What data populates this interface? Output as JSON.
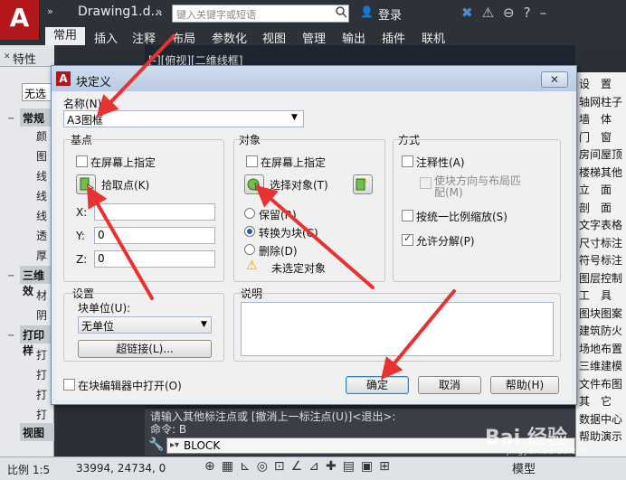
{
  "app": {
    "logo": "A",
    "qat_arrows": "»",
    "doc_title": "Drawing1.d...",
    "title_more": "»",
    "search_placeholder": "键入关键字或短语",
    "login": "登录",
    "tabs": [
      "常用",
      "插入",
      "注释",
      "布局",
      "参数化",
      "视图",
      "管理",
      "输出",
      "插件",
      "联机"
    ]
  },
  "palette": {
    "title": "特性",
    "no_selection": "无选",
    "sections": [
      {
        "label": "常规",
        "items": [
          "颜",
          "图",
          "线",
          "线",
          "线",
          "透",
          "厚"
        ]
      },
      {
        "label": "三维效",
        "items": [
          "材",
          "阴"
        ]
      },
      {
        "label": "打印样",
        "items": [
          "打",
          "打",
          "打",
          "打"
        ]
      },
      {
        "label": "视图",
        "items": []
      }
    ]
  },
  "drawing": {
    "viewport_label": "[-][俯视][二维线框]"
  },
  "right_panel": {
    "items": [
      "设　置",
      "轴网柱子",
      "墙　体",
      "门　窗",
      "房间屋顶",
      "楼梯其他",
      "立　面",
      "剖　面",
      "文字表格",
      "尺寸标注",
      "符号标注",
      "图层控制",
      "工　具",
      "图块图案",
      "建筑防火",
      "场地布置",
      "三维建模",
      "文件布图",
      "其　它",
      "数据中心",
      "帮助演示"
    ]
  },
  "command": {
    "line1": "请输入其他标注点或 [撤消上一标注点(U)]<退出>:",
    "line2": "命令: B",
    "input": "BLOCK"
  },
  "status": {
    "scale": "比例 1:5",
    "coords": "33994, 24734, 0",
    "model": "模型"
  },
  "dialog": {
    "title": "块定义",
    "close": "✕",
    "name_label": "名称(N):",
    "name_value": "A3图框",
    "base_point": {
      "title": "基点",
      "specify_on_screen": "在屏幕上指定",
      "pick_point": "拾取点(K)",
      "x_label": "X:",
      "y_label": "Y:",
      "z_label": "Z:",
      "x_value": "",
      "y_value": "0",
      "z_value": "0"
    },
    "objects": {
      "title": "对象",
      "specify_on_screen": "在屏幕上指定",
      "select_objects": "选择对象(T)",
      "retain": "保留(R)",
      "convert": "转换为块(C)",
      "delete": "删除(D)",
      "warning": "未选定对象",
      "selected_option": "convert"
    },
    "behavior": {
      "title": "方式",
      "annotative": "注释性(A)",
      "match_orientation": "使块方向与布局匹配(M)",
      "scale_uniformly": "按统一比例缩放(S)",
      "allow_exploding": "允许分解(P)",
      "allow_exploding_checked": true
    },
    "settings": {
      "title": "设置",
      "block_unit_label": "块单位(U):",
      "block_unit_value": "无单位",
      "hyperlink": "超链接(L)..."
    },
    "description": {
      "title": "说明"
    },
    "open_in_editor": "在块编辑器中打开(O)",
    "ok": "确定",
    "cancel": "取消",
    "help": "帮助(H)"
  },
  "watermark": {
    "text": "Bai 经验",
    "sub": "jingyan.baidu.com"
  },
  "colors": {
    "accent_red": "#e8322f",
    "dialog_border": "#6d87a8"
  }
}
